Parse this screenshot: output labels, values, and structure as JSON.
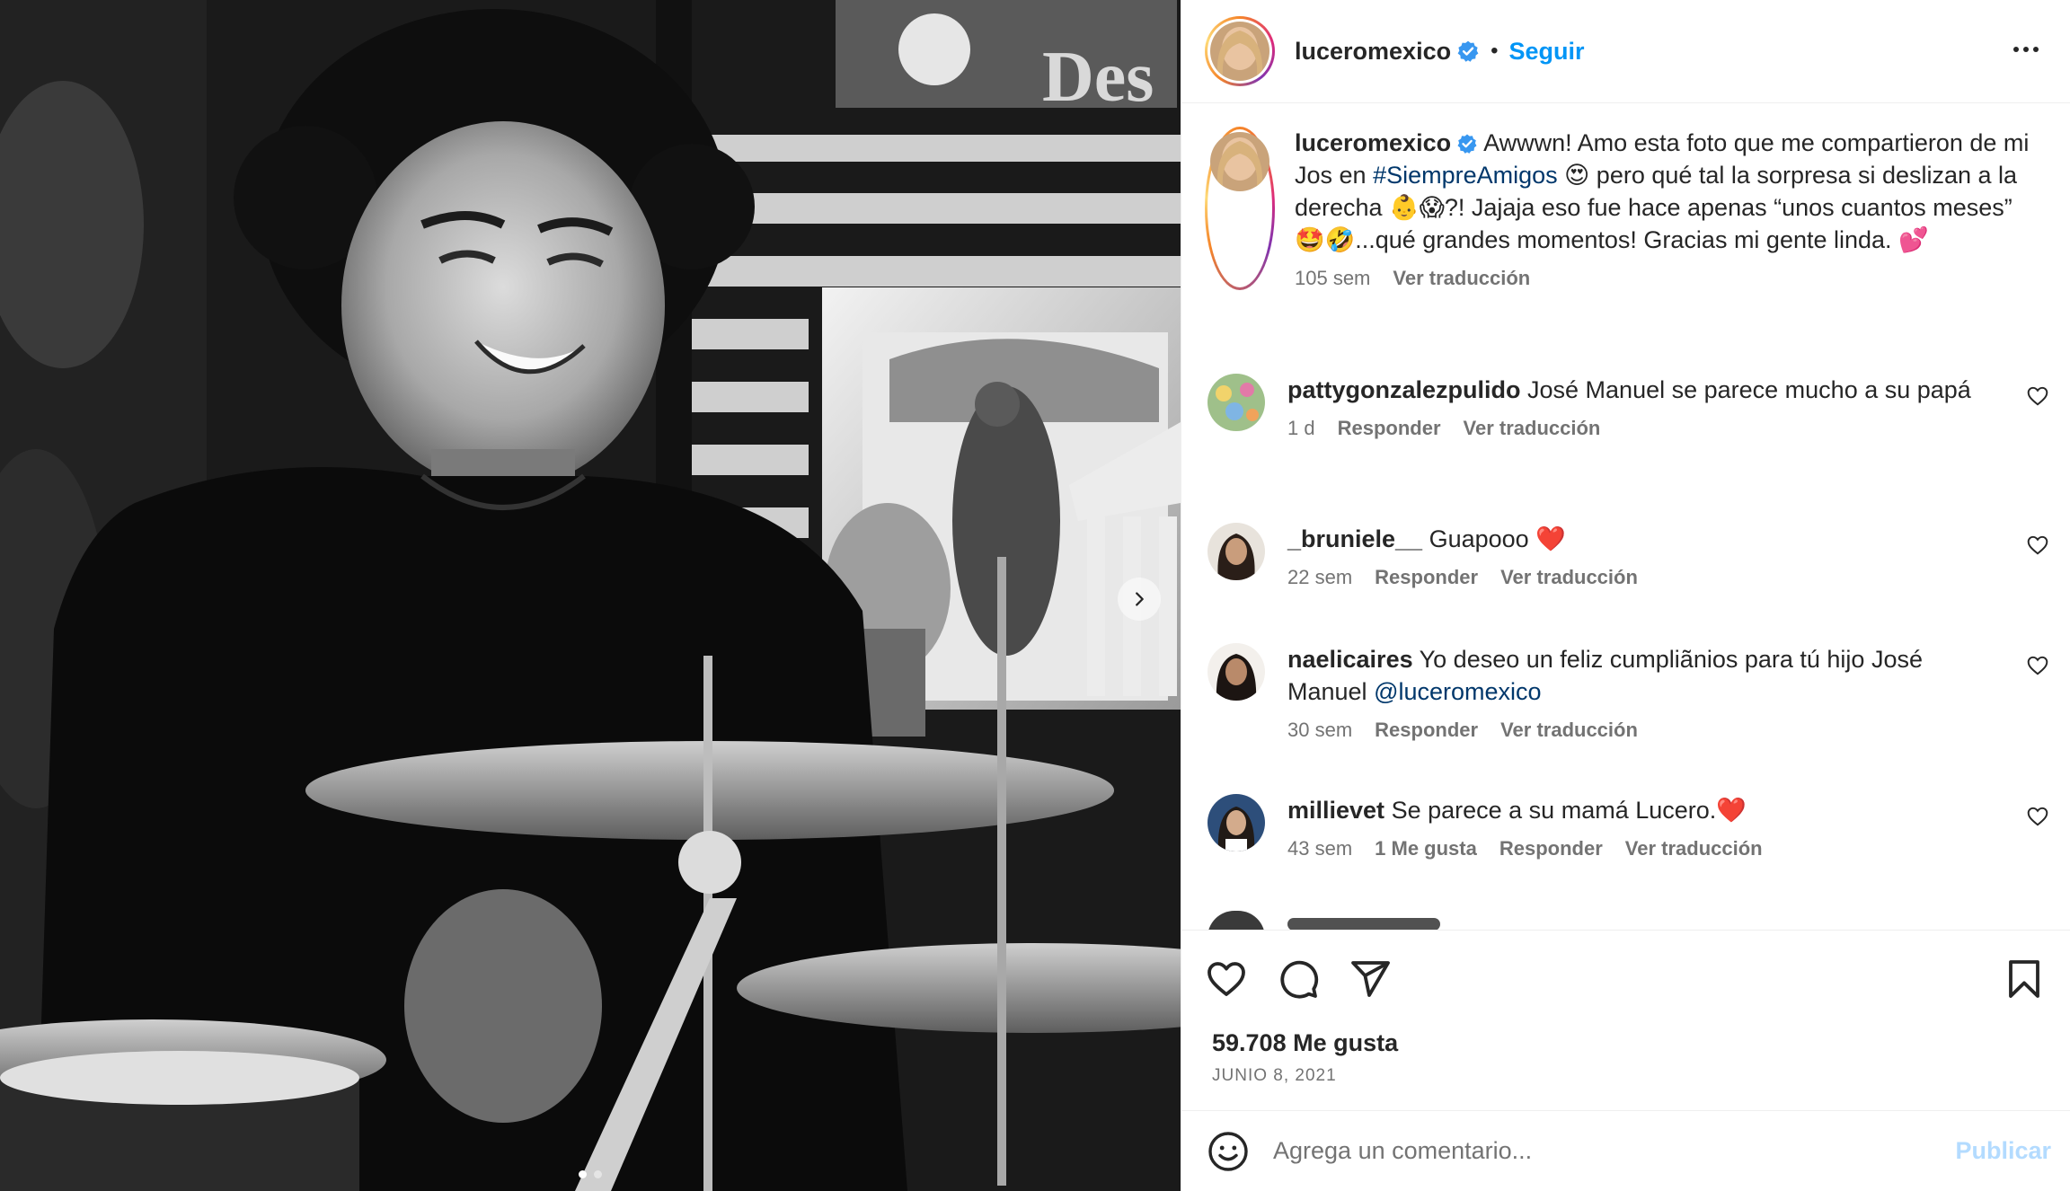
{
  "post": {
    "username": "luceromexico",
    "follow_label": "Seguir",
    "separator": "•"
  },
  "caption": {
    "username": "luceromexico",
    "text_before": "Awwwn! Amo esta foto que me compartieron de mi Jos en ",
    "hashtag": "#SiempreAmigos",
    "text_after": " 😍 pero qué tal la sorpresa si deslizan a la derecha 👶😱?! Jajaja eso fue hace apenas “unos cuantos meses” 🤩🤣...qué grandes momentos! Gracias mi gente linda. 💕",
    "time": "105 sem",
    "translate": "Ver traducción"
  },
  "comments": [
    {
      "username": "pattygonzalezpulido",
      "text": "José Manuel se parece mucho a su papá",
      "time": "1 d",
      "reply": "Responder",
      "translate": "Ver traducción"
    },
    {
      "username": "_bruniele__",
      "text": "Guapooo ❤️",
      "time": "22 sem",
      "reply": "Responder",
      "translate": "Ver traducción"
    },
    {
      "username": "naelicaires",
      "text": "Yo deseo un feliz cumpliãnios para tú hijo José Manuel ",
      "mention": "@luceromexico",
      "time": "30 sem",
      "reply": "Responder",
      "translate": "Ver traducción"
    },
    {
      "username": "millievet",
      "text": "Se parece a su mamá Lucero.❤️",
      "time": "43 sem",
      "likes": "1 Me gusta",
      "reply": "Responder",
      "translate": "Ver traducción"
    }
  ],
  "stats": {
    "likes": "59.708 Me gusta",
    "date": "JUNIO 8, 2021"
  },
  "comment_box": {
    "placeholder": "Agrega un comentario...",
    "publish": "Publicar"
  },
  "carousel": {
    "slide_count": 2,
    "active_index": 0
  },
  "icons": {
    "verified": "verified-badge-icon",
    "more": "more-options-icon",
    "next": "chevron-right-icon",
    "like": "heart-icon",
    "comment": "comment-icon",
    "share": "send-icon",
    "save": "bookmark-icon",
    "emoji": "emoji-icon"
  },
  "colors": {
    "link": "#0095f6",
    "hashtag": "#00376b",
    "verified": "#3897f0",
    "muted": "#737373",
    "publish_disabled": "#b3dbff"
  }
}
